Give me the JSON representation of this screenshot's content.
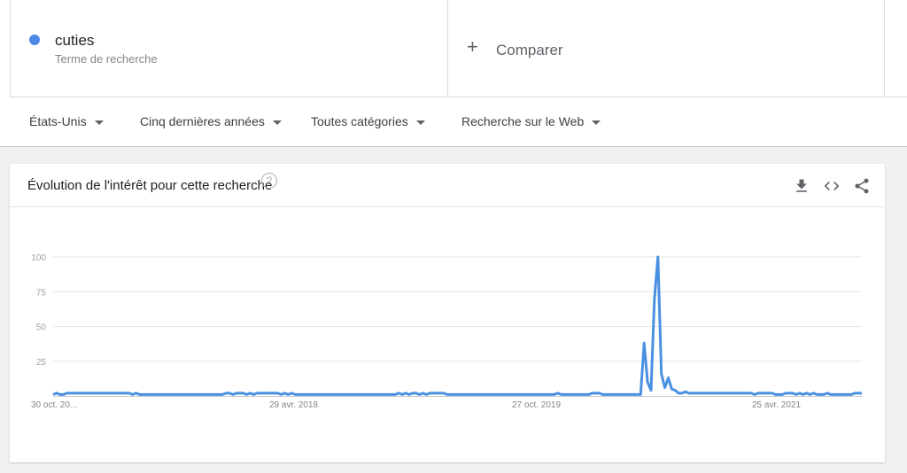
{
  "search_term": {
    "label": "cuties",
    "sublabel": "Terme de recherche",
    "color": "#4e86e6"
  },
  "compare": {
    "label": "Comparer",
    "icon": "plus-icon"
  },
  "filters": [
    {
      "label": "États-Unis"
    },
    {
      "label": "Cinq dernières années"
    },
    {
      "label": "Toutes catégories"
    },
    {
      "label": "Recherche sur le Web"
    }
  ],
  "panel": {
    "title": "Évolution de l'intérêt pour cette recherche",
    "help_icon": "?",
    "actions": [
      "download-icon",
      "embed-icon",
      "share-icon"
    ]
  },
  "chart_data": {
    "type": "line",
    "title": "",
    "xlabel": "",
    "ylabel": "",
    "ylim": [
      0,
      100
    ],
    "y_ticks": [
      25,
      50,
      75,
      100
    ],
    "x_ticks": [
      "30 oct. 20...",
      "29 avr. 2018",
      "27 oct. 2019",
      "25 avr. 2021"
    ],
    "grid": true,
    "series": [
      {
        "color": "#4a90e2",
        "values": [
          1,
          2,
          1,
          1,
          2,
          2,
          2,
          2,
          2,
          2,
          2,
          2,
          2,
          2,
          2,
          2,
          2,
          2,
          2,
          2,
          2,
          2,
          2,
          1,
          2,
          1,
          1,
          1,
          1,
          1,
          1,
          1,
          1,
          1,
          1,
          1,
          1,
          1,
          1,
          1,
          1,
          1,
          1,
          1,
          1,
          1,
          1,
          1,
          1,
          1,
          2,
          2,
          1,
          2,
          2,
          2,
          1,
          2,
          1,
          2,
          2,
          2,
          2,
          2,
          2,
          2,
          1,
          2,
          1,
          2,
          1,
          1,
          1,
          1,
          1,
          1,
          1,
          1,
          1,
          1,
          1,
          1,
          1,
          1,
          1,
          1,
          1,
          1,
          1,
          1,
          1,
          1,
          1,
          1,
          1,
          1,
          1,
          1,
          1,
          1,
          2,
          1,
          2,
          1,
          2,
          2,
          1,
          2,
          1,
          2,
          2,
          2,
          2,
          2,
          1,
          1,
          1,
          1,
          1,
          1,
          1,
          1,
          1,
          1,
          1,
          1,
          1,
          1,
          1,
          1,
          1,
          1,
          1,
          1,
          1,
          1,
          1,
          1,
          1,
          1,
          1,
          1,
          1,
          1,
          1,
          1,
          2,
          1,
          1,
          1,
          1,
          1,
          1,
          1,
          1,
          1,
          2,
          2,
          2,
          1,
          1,
          1,
          1,
          1,
          1,
          1,
          1,
          1,
          1,
          1,
          1,
          38,
          10,
          4,
          70,
          100,
          16,
          6,
          13,
          5,
          4,
          2,
          2,
          3,
          2,
          2,
          2,
          2,
          2,
          2,
          2,
          2,
          2,
          2,
          2,
          2,
          2,
          2,
          2,
          2,
          2,
          2,
          2,
          1,
          2,
          2,
          2,
          2,
          2,
          1,
          1,
          1,
          2,
          2,
          2,
          1,
          2,
          1,
          2,
          1,
          2,
          1,
          1,
          1,
          2,
          1,
          1,
          1,
          1,
          1,
          1,
          1,
          2,
          2,
          2
        ]
      }
    ]
  }
}
